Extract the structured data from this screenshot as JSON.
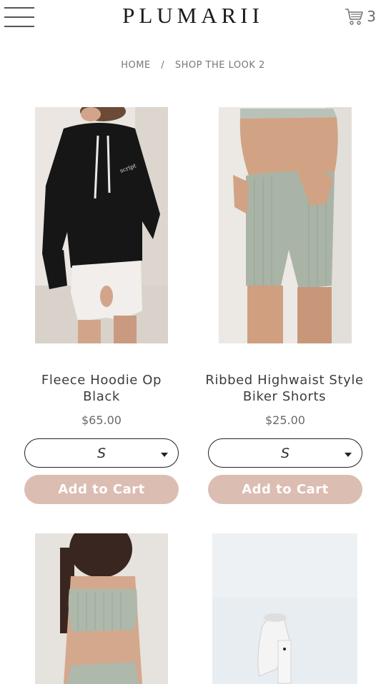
{
  "header": {
    "logo": "PLUMARII",
    "cart_count": "3"
  },
  "breadcrumb": {
    "home": "HOME",
    "separator": "/",
    "current": "SHOP THE LOOK 2"
  },
  "products": [
    {
      "title": "Fleece Hoodie Op Black",
      "price": "$65.00",
      "size": "S",
      "button": "Add to Cart"
    },
    {
      "title": "Ribbed Highwaist Style Biker Shorts",
      "price": "$25.00",
      "size": "S",
      "button": "Add to Cart"
    },
    {},
    {}
  ],
  "colors": {
    "add_to_cart_bg": "#dcbdb2",
    "text": "#3d3d3d"
  }
}
